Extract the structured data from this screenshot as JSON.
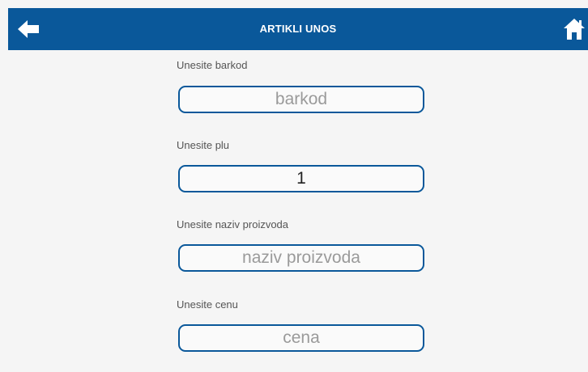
{
  "header": {
    "title": "ARTIKLI UNOS",
    "back_icon": "arrow-left-icon",
    "home_icon": "home-icon",
    "bar_color": "#0a589a"
  },
  "form": {
    "fields": [
      {
        "label": "Unesite barkod",
        "placeholder": "barkod",
        "value": ""
      },
      {
        "label": "Unesite plu",
        "placeholder": "",
        "value": "1"
      },
      {
        "label": "Unesite naziv proizvoda",
        "placeholder": "naziv proizvoda",
        "value": ""
      },
      {
        "label": "Unesite cenu",
        "placeholder": "cena",
        "value": ""
      }
    ]
  }
}
